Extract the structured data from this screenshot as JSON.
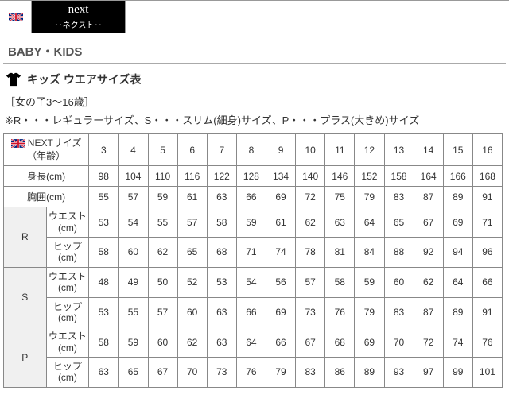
{
  "topbar": {
    "brand_main": "next",
    "brand_sub": "‥ネクスト‥"
  },
  "section_title": "BABY・KIDS",
  "subhead_title": "キッズ ウエアサイズ表",
  "range_line": "［女の子3～16歳］",
  "note_line": "※R・・・レギュラーサイズ、S・・・スリム(細身)サイズ、P・・・プラス(大きめ)サイズ",
  "chart_data": {
    "type": "table",
    "header_label_top": "NEXTサイズ",
    "header_label_bottom": "（年齢）",
    "sizes": [
      "3",
      "4",
      "5",
      "6",
      "7",
      "8",
      "9",
      "10",
      "11",
      "12",
      "13",
      "14",
      "15",
      "16"
    ],
    "rows_simple": [
      {
        "label": "身長(cm)",
        "values": [
          "98",
          "104",
          "110",
          "116",
          "122",
          "128",
          "134",
          "140",
          "146",
          "152",
          "158",
          "164",
          "166",
          "168"
        ]
      },
      {
        "label": "胸囲(cm)",
        "values": [
          "55",
          "57",
          "59",
          "61",
          "63",
          "66",
          "69",
          "72",
          "75",
          "79",
          "83",
          "87",
          "89",
          "91"
        ]
      }
    ],
    "groups": [
      {
        "code": "R",
        "rows": [
          {
            "label_top": "ウエスト",
            "label_bottom": "(cm)",
            "values": [
              "53",
              "54",
              "55",
              "57",
              "58",
              "59",
              "61",
              "62",
              "63",
              "64",
              "65",
              "67",
              "69",
              "71"
            ]
          },
          {
            "label_top": "ヒップ",
            "label_bottom": "(cm)",
            "values": [
              "58",
              "60",
              "62",
              "65",
              "68",
              "71",
              "74",
              "78",
              "81",
              "84",
              "88",
              "92",
              "94",
              "96"
            ]
          }
        ]
      },
      {
        "code": "S",
        "rows": [
          {
            "label_top": "ウエスト",
            "label_bottom": "(cm)",
            "values": [
              "48",
              "49",
              "50",
              "52",
              "53",
              "54",
              "56",
              "57",
              "58",
              "59",
              "60",
              "62",
              "64",
              "66"
            ]
          },
          {
            "label_top": "ヒップ",
            "label_bottom": "(cm)",
            "values": [
              "53",
              "55",
              "57",
              "60",
              "63",
              "66",
              "69",
              "73",
              "76",
              "79",
              "83",
              "87",
              "89",
              "91"
            ]
          }
        ]
      },
      {
        "code": "P",
        "rows": [
          {
            "label_top": "ウエスト",
            "label_bottom": "(cm)",
            "values": [
              "58",
              "59",
              "60",
              "62",
              "63",
              "64",
              "66",
              "67",
              "68",
              "69",
              "70",
              "72",
              "74",
              "76"
            ]
          },
          {
            "label_top": "ヒップ",
            "label_bottom": "(cm)",
            "values": [
              "63",
              "65",
              "67",
              "70",
              "73",
              "76",
              "79",
              "83",
              "86",
              "89",
              "93",
              "97",
              "99",
              "101"
            ]
          }
        ]
      }
    ]
  }
}
